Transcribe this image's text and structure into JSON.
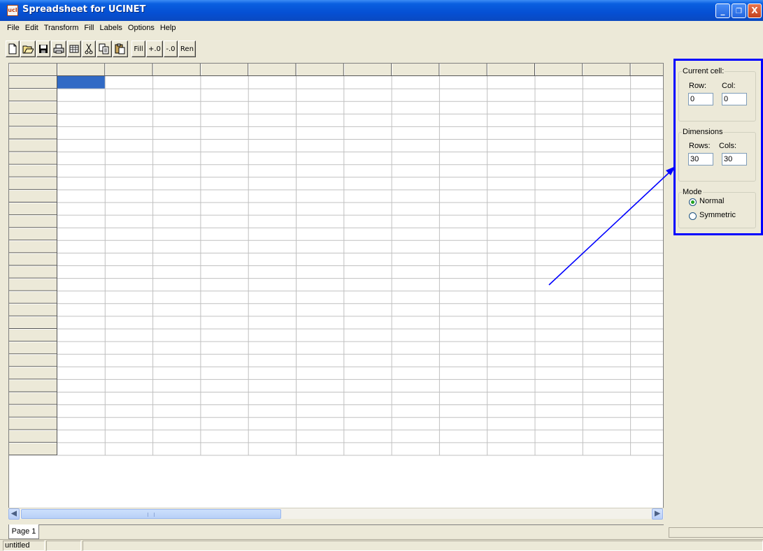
{
  "window": {
    "title": "Spreadsheet for UCINET",
    "icon_text": "ucI",
    "minimize": "_",
    "maximize": "❐",
    "close": "X"
  },
  "menu": [
    "File",
    "Edit",
    "Transform",
    "Fill",
    "Labels",
    "Options",
    "Help"
  ],
  "toolbar": {
    "icons": [
      "new-icon",
      "open-icon",
      "save-icon",
      "print-icon",
      "grid-icon",
      "cut-icon",
      "copy-icon",
      "paste-icon"
    ],
    "fill_label": "Fill",
    "plus_label": "+.0",
    "minus_label": "-.0",
    "ren_label": "Ren"
  },
  "grid": {
    "visible_rows": 30,
    "visible_cols": 13,
    "selected_cell": "row 0, col 0",
    "selection_color": "#316ac5"
  },
  "current_cell": {
    "legend": "Current cell:",
    "row_label": "Row:",
    "col_label": "Col:",
    "row_value": "0",
    "col_value": "0"
  },
  "dimensions": {
    "legend": "Dimensions",
    "rows_label": "Rows:",
    "cols_label": "Cols:",
    "rows_value": "30",
    "cols_value": "30"
  },
  "mode": {
    "legend": "Mode",
    "options": [
      "Normal",
      "Symmetric"
    ],
    "selected": "Normal"
  },
  "sheet_tab": "Page 1",
  "status": {
    "file": "untitled"
  },
  "annotation_color": "#0000ff"
}
